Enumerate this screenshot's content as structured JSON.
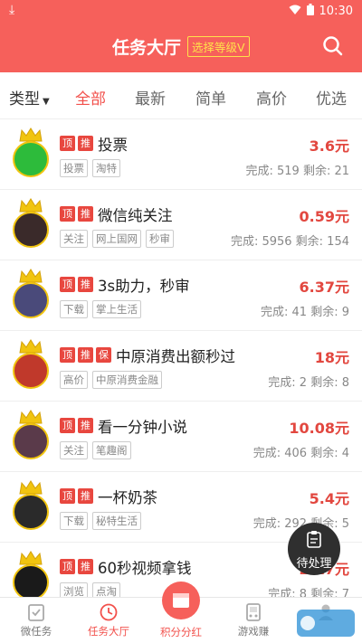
{
  "status": {
    "time": "10:30"
  },
  "header": {
    "title": "任务大厅",
    "level_button": "选择等级V"
  },
  "tabs": {
    "type_label": "类型",
    "all": "全部",
    "latest": "最新",
    "simple": "简单",
    "high_price": "高价",
    "featured": "优选"
  },
  "tasks": [
    {
      "badges": [
        "顶",
        "推"
      ],
      "title": "投票",
      "price": "3.6元",
      "tags": [
        "投票",
        "淘特"
      ],
      "stats": "完成: 519  剩余: 21",
      "avatar_color": "#2dbb3b"
    },
    {
      "badges": [
        "顶",
        "推"
      ],
      "title": "微信纯关注",
      "price": "0.59元",
      "tags": [
        "关注",
        "网上国网",
        "秒审"
      ],
      "stats": "完成: 5956  剩余: 154",
      "avatar_color": "#3a2a2a"
    },
    {
      "badges": [
        "顶",
        "推"
      ],
      "title": "3s助力，秒审",
      "price": "6.37元",
      "tags": [
        "下载",
        "掌上生活"
      ],
      "stats": "完成: 41  剩余: 9",
      "avatar_color": "#4a4a7a"
    },
    {
      "badges": [
        "顶",
        "推",
        "保"
      ],
      "title": "中原消费出额秒过",
      "price": "18元",
      "tags": [
        "高价",
        "中原消费金融"
      ],
      "stats": "完成: 2  剩余: 8",
      "avatar_color": "#c0392b"
    },
    {
      "badges": [
        "顶",
        "推"
      ],
      "title": "看一分钟小说",
      "price": "10.08元",
      "tags": [
        "关注",
        "笔趣阁"
      ],
      "stats": "完成: 406  剩余: 4",
      "avatar_color": "#5a3a4a"
    },
    {
      "badges": [
        "顶",
        "推"
      ],
      "title": "一杯奶茶",
      "price": "5.4元",
      "tags": [
        "下载",
        "秘特生活"
      ],
      "stats": "完成: 292  剩余: 5",
      "avatar_color": "#2a2a2a"
    },
    {
      "badges": [
        "顶",
        "推"
      ],
      "title": "60秒视频拿钱",
      "price": "2.17元",
      "tags": [
        "浏览",
        "点淘"
      ],
      "stats": "完成: 8  剩余: 7",
      "avatar_color": "#1a1a1a"
    }
  ],
  "float_button": {
    "label": "待处理"
  },
  "bottom_nav": [
    {
      "label": "微任务"
    },
    {
      "label": "任务大厅"
    },
    {
      "label": "积分分红"
    },
    {
      "label": "游戏赚"
    },
    {
      "label": ""
    }
  ],
  "colors": {
    "brand": "#f6605b",
    "price": "#e2473f",
    "badge": "#e8473f",
    "level_border": "#ffe24a"
  },
  "icons": {
    "search": "search-icon",
    "download": "download-icon",
    "wifi": "wifi-icon",
    "battery": "battery-icon",
    "clipboard": "clipboard-icon",
    "crown": "crown-icon"
  }
}
